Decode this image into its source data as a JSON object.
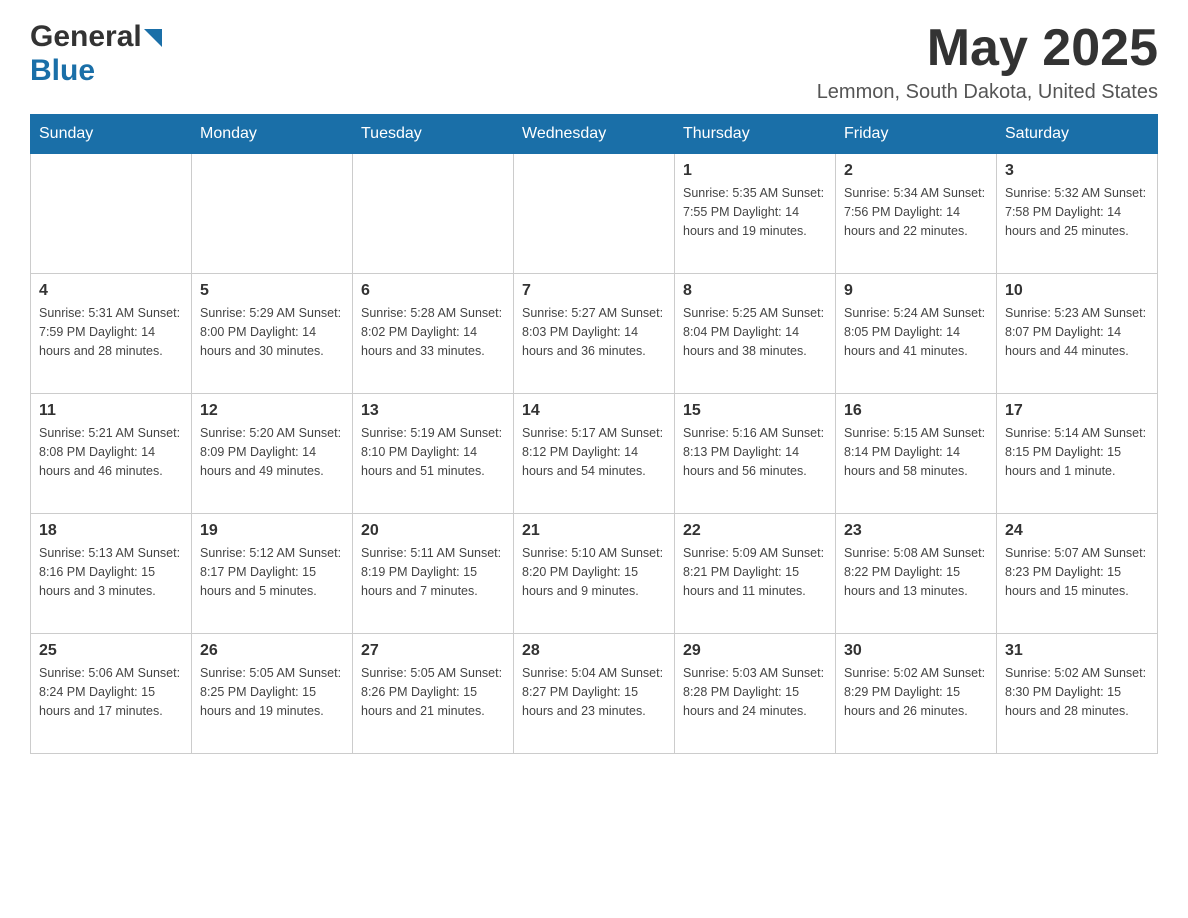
{
  "header": {
    "logo_general": "General",
    "logo_blue": "Blue",
    "title": "May 2025",
    "location": "Lemmon, South Dakota, United States"
  },
  "calendar": {
    "days_of_week": [
      "Sunday",
      "Monday",
      "Tuesday",
      "Wednesday",
      "Thursday",
      "Friday",
      "Saturday"
    ],
    "weeks": [
      [
        {
          "day": "",
          "info": ""
        },
        {
          "day": "",
          "info": ""
        },
        {
          "day": "",
          "info": ""
        },
        {
          "day": "",
          "info": ""
        },
        {
          "day": "1",
          "info": "Sunrise: 5:35 AM\nSunset: 7:55 PM\nDaylight: 14 hours\nand 19 minutes."
        },
        {
          "day": "2",
          "info": "Sunrise: 5:34 AM\nSunset: 7:56 PM\nDaylight: 14 hours\nand 22 minutes."
        },
        {
          "day": "3",
          "info": "Sunrise: 5:32 AM\nSunset: 7:58 PM\nDaylight: 14 hours\nand 25 minutes."
        }
      ],
      [
        {
          "day": "4",
          "info": "Sunrise: 5:31 AM\nSunset: 7:59 PM\nDaylight: 14 hours\nand 28 minutes."
        },
        {
          "day": "5",
          "info": "Sunrise: 5:29 AM\nSunset: 8:00 PM\nDaylight: 14 hours\nand 30 minutes."
        },
        {
          "day": "6",
          "info": "Sunrise: 5:28 AM\nSunset: 8:02 PM\nDaylight: 14 hours\nand 33 minutes."
        },
        {
          "day": "7",
          "info": "Sunrise: 5:27 AM\nSunset: 8:03 PM\nDaylight: 14 hours\nand 36 minutes."
        },
        {
          "day": "8",
          "info": "Sunrise: 5:25 AM\nSunset: 8:04 PM\nDaylight: 14 hours\nand 38 minutes."
        },
        {
          "day": "9",
          "info": "Sunrise: 5:24 AM\nSunset: 8:05 PM\nDaylight: 14 hours\nand 41 minutes."
        },
        {
          "day": "10",
          "info": "Sunrise: 5:23 AM\nSunset: 8:07 PM\nDaylight: 14 hours\nand 44 minutes."
        }
      ],
      [
        {
          "day": "11",
          "info": "Sunrise: 5:21 AM\nSunset: 8:08 PM\nDaylight: 14 hours\nand 46 minutes."
        },
        {
          "day": "12",
          "info": "Sunrise: 5:20 AM\nSunset: 8:09 PM\nDaylight: 14 hours\nand 49 minutes."
        },
        {
          "day": "13",
          "info": "Sunrise: 5:19 AM\nSunset: 8:10 PM\nDaylight: 14 hours\nand 51 minutes."
        },
        {
          "day": "14",
          "info": "Sunrise: 5:17 AM\nSunset: 8:12 PM\nDaylight: 14 hours\nand 54 minutes."
        },
        {
          "day": "15",
          "info": "Sunrise: 5:16 AM\nSunset: 8:13 PM\nDaylight: 14 hours\nand 56 minutes."
        },
        {
          "day": "16",
          "info": "Sunrise: 5:15 AM\nSunset: 8:14 PM\nDaylight: 14 hours\nand 58 minutes."
        },
        {
          "day": "17",
          "info": "Sunrise: 5:14 AM\nSunset: 8:15 PM\nDaylight: 15 hours\nand 1 minute."
        }
      ],
      [
        {
          "day": "18",
          "info": "Sunrise: 5:13 AM\nSunset: 8:16 PM\nDaylight: 15 hours\nand 3 minutes."
        },
        {
          "day": "19",
          "info": "Sunrise: 5:12 AM\nSunset: 8:17 PM\nDaylight: 15 hours\nand 5 minutes."
        },
        {
          "day": "20",
          "info": "Sunrise: 5:11 AM\nSunset: 8:19 PM\nDaylight: 15 hours\nand 7 minutes."
        },
        {
          "day": "21",
          "info": "Sunrise: 5:10 AM\nSunset: 8:20 PM\nDaylight: 15 hours\nand 9 minutes."
        },
        {
          "day": "22",
          "info": "Sunrise: 5:09 AM\nSunset: 8:21 PM\nDaylight: 15 hours\nand 11 minutes."
        },
        {
          "day": "23",
          "info": "Sunrise: 5:08 AM\nSunset: 8:22 PM\nDaylight: 15 hours\nand 13 minutes."
        },
        {
          "day": "24",
          "info": "Sunrise: 5:07 AM\nSunset: 8:23 PM\nDaylight: 15 hours\nand 15 minutes."
        }
      ],
      [
        {
          "day": "25",
          "info": "Sunrise: 5:06 AM\nSunset: 8:24 PM\nDaylight: 15 hours\nand 17 minutes."
        },
        {
          "day": "26",
          "info": "Sunrise: 5:05 AM\nSunset: 8:25 PM\nDaylight: 15 hours\nand 19 minutes."
        },
        {
          "day": "27",
          "info": "Sunrise: 5:05 AM\nSunset: 8:26 PM\nDaylight: 15 hours\nand 21 minutes."
        },
        {
          "day": "28",
          "info": "Sunrise: 5:04 AM\nSunset: 8:27 PM\nDaylight: 15 hours\nand 23 minutes."
        },
        {
          "day": "29",
          "info": "Sunrise: 5:03 AM\nSunset: 8:28 PM\nDaylight: 15 hours\nand 24 minutes."
        },
        {
          "day": "30",
          "info": "Sunrise: 5:02 AM\nSunset: 8:29 PM\nDaylight: 15 hours\nand 26 minutes."
        },
        {
          "day": "31",
          "info": "Sunrise: 5:02 AM\nSunset: 8:30 PM\nDaylight: 15 hours\nand 28 minutes."
        }
      ]
    ]
  }
}
